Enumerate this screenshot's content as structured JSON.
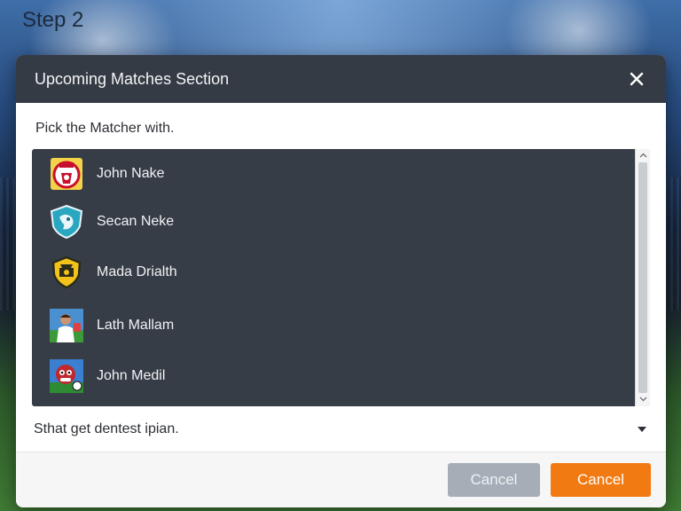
{
  "page": {
    "step_title": "Step 2"
  },
  "dialog": {
    "title": "Upcoming Matches Section",
    "close_icon": "close-icon",
    "prompt": "Pick the Matcher with.",
    "items": [
      {
        "label": "John Nake",
        "icon": "red-crest-logo-icon"
      },
      {
        "label": "Secan Neke",
        "icon": "blue-crest-logo-icon"
      },
      {
        "label": "Mada Drialth",
        "icon": "yellow-crest-logo-icon"
      },
      {
        "label": "Lath Mallam",
        "icon": "player-avatar-icon"
      },
      {
        "label": "John Medil",
        "icon": "mascot-avatar-icon"
      }
    ],
    "select": {
      "value": "Sthat get dentest ipian.",
      "icon": "chevron-down-icon"
    },
    "buttons": {
      "secondary_label": "Cancel",
      "primary_label": "Cancel"
    }
  },
  "colors": {
    "header_bg": "#353b45",
    "list_bg": "#373d47",
    "primary_button": "#f27a12",
    "secondary_button": "#a5aeb7"
  }
}
